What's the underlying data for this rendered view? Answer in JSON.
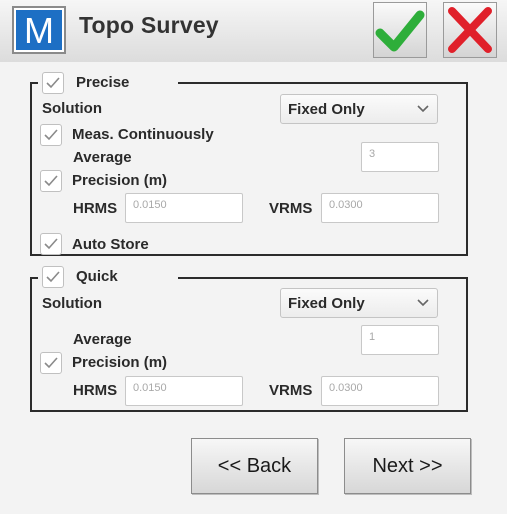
{
  "app": {
    "logo_letter": "M",
    "title": "Topo Survey",
    "accept_icon": "checkmark-icon",
    "cancel_icon": "close-x-icon",
    "colors": {
      "accept": "#2eae3a",
      "cancel": "#e0202a",
      "logo_bg": "#1d6fc4"
    }
  },
  "precise": {
    "legend": "Precise",
    "checked": true,
    "solution_label": "Solution",
    "solution_value": "Fixed Only",
    "meas_continuously_label": "Meas. Continuously",
    "meas_continuously_checked": true,
    "average_label": "Average",
    "average_value": "3",
    "precision_label": "Precision (m)",
    "precision_checked": true,
    "hrms_label": "HRMS",
    "hrms_value": "0.0150",
    "vrms_label": "VRMS",
    "vrms_value": "0.0300",
    "auto_store_label": "Auto Store",
    "auto_store_checked": true
  },
  "quick": {
    "legend": "Quick",
    "checked": true,
    "solution_label": "Solution",
    "solution_value": "Fixed Only",
    "average_label": "Average",
    "average_value": "1",
    "precision_label": "Precision (m)",
    "precision_checked": true,
    "hrms_label": "HRMS",
    "hrms_value": "0.0150",
    "vrms_label": "VRMS",
    "vrms_value": "0.0300"
  },
  "footer": {
    "back_label": "<< Back",
    "next_label": "Next >>"
  }
}
